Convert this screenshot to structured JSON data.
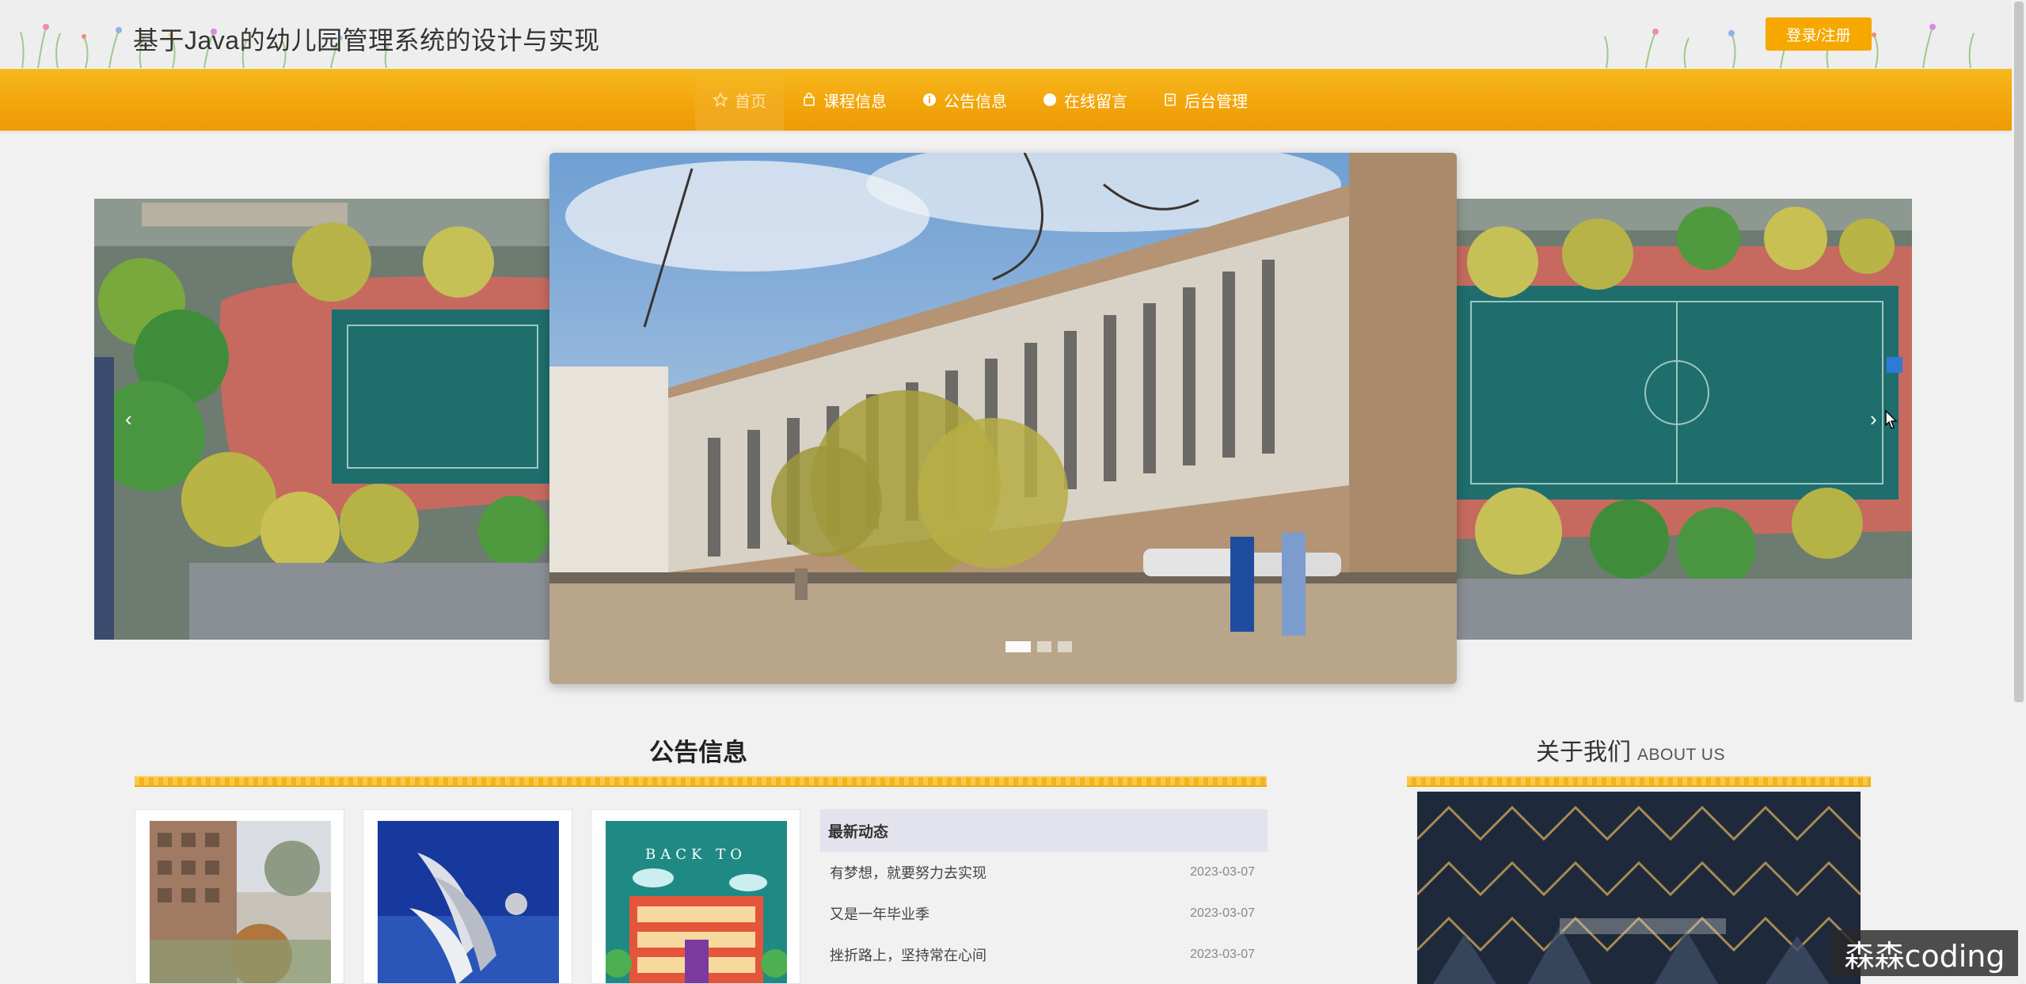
{
  "header": {
    "title": "基于Java的幼儿园管理系统的设计与实现",
    "login_label": "登录/注册"
  },
  "nav": {
    "items": [
      {
        "label": "首页",
        "icon": "star-icon",
        "active": true
      },
      {
        "label": "课程信息",
        "icon": "bag-icon"
      },
      {
        "label": "公告信息",
        "icon": "info-icon"
      },
      {
        "label": "在线留言",
        "icon": "chat-icon"
      },
      {
        "label": "后台管理",
        "icon": "doc-icon"
      }
    ]
  },
  "carousel": {
    "slide_count": 3,
    "active_index": 0,
    "prev_glyph": "‹",
    "next_glyph": "›"
  },
  "notices": {
    "title": "公告信息",
    "news_heading": "最新动态",
    "items": [
      {
        "title": "有梦想，就要努力去实现",
        "date": "2023-03-07"
      },
      {
        "title": "又是一年毕业季",
        "date": "2023-03-07"
      },
      {
        "title": "挫折路上，坚持常在心间",
        "date": "2023-03-07"
      }
    ],
    "card3_caption": "BACK TO"
  },
  "about": {
    "title": "关于我们",
    "subtitle": "ABOUT US"
  },
  "watermark": "森森coding",
  "colors": {
    "accent": "#f6a800",
    "nav_bg": "#f2a60c",
    "page_bg": "#f1f1f1"
  }
}
